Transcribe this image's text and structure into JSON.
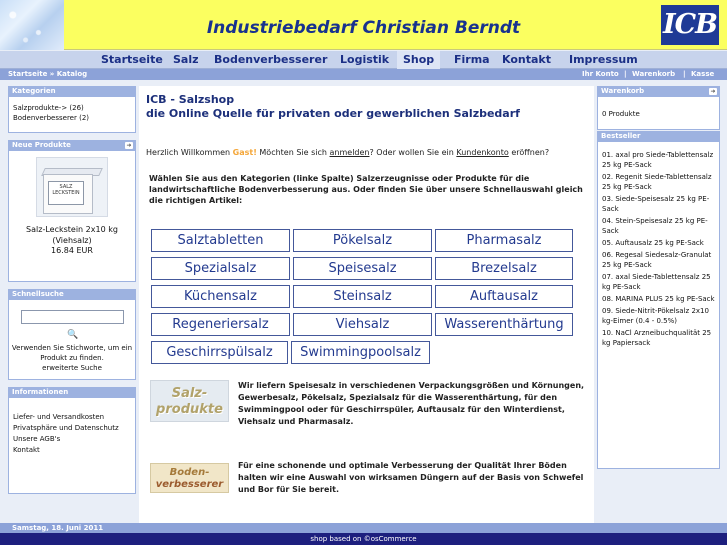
{
  "header": {
    "title": "Industriebedarf Christian Berndt",
    "logo": "ICB"
  },
  "nav": [
    "Startseite",
    "Salz",
    "Bodenverbesserer",
    "Logistik",
    "Shop",
    "Firma",
    "Kontakt",
    "Impressum"
  ],
  "nav_active": "Shop",
  "breadcrumb": "Startseite » Katalog",
  "account_links": [
    "Ihr Konto",
    "|",
    "Warenkorb",
    "|",
    "Kasse"
  ],
  "left": {
    "categories": {
      "title": "Kategorien",
      "items": [
        "Salzprodukte-> (26)",
        "Bodenverbesserer (2)"
      ]
    },
    "new_products": {
      "title": "Neue Produkte",
      "image_label": [
        "SALZ",
        "LECKSTEIN"
      ],
      "name": "Salz-Leckstein 2x10 kg (Viehsalz)",
      "price": "16.84 EUR"
    },
    "quick_search": {
      "title": "Schnellsuche",
      "input_value": "",
      "help": "Verwenden Sie Stichworte, um ein Produkt zu finden.",
      "advanced": "erweiterte Suche"
    },
    "information": {
      "title": "Informationen",
      "items": [
        "Liefer- und Versandkosten",
        "Privatsphäre und Datenschutz",
        "Unsere AGB's",
        "Kontakt"
      ]
    }
  },
  "right": {
    "cart": {
      "title": "Warenkorb",
      "text": "0 Produkte"
    },
    "bestseller": {
      "title": "Bestseller",
      "items": [
        "01. axal pro Siede-Tablettensalz 25 kg PE-Sack",
        "02. Regenit Siede-Tablettensalz 25 kg PE-Sack",
        "03. Siede-Speisesalz 25 kg PE-Sack",
        "04. Stein-Speisesalz 25 kg PE-Sack",
        "05. Auftausalz 25 kg PE-Sack",
        "06. Regesal Siedesalz-Granulat 25 kg PE-Sack",
        "07. axal Siede-Tablettensalz 25 kg PE-Sack",
        "08. MARINA PLUS 25 kg PE-Sack",
        "09. Siede-Nitrit-Pökelsalz 2x10 kg-Eimer (0.4 - 0.5%)",
        "10. NaCl Arzneibuchqualität 25 kg Papiersack"
      ]
    }
  },
  "main": {
    "title_line1": "ICB - Salzshop",
    "title_line2": "die Online Quelle für privaten oder gewerblichen Salzbedarf",
    "welcome": {
      "prefix": "Herzlich Willkommen",
      "guest": "Gast!",
      "middle": "Möchten Sie sich",
      "login": "anmelden",
      "mid2": "? Oder wollen Sie ein",
      "account": "Kundenkonto",
      "suffix": "eröffnen?"
    },
    "intro": "Wählen Sie aus den Kategorien (linke Spalte) Salzerzeugnisse oder Produkte für die landwirtschaftliche Bodenverbesserung aus. Oder finden Sie über unsere Schnellauswahl gleich die richtigen Artikel:",
    "categories": [
      "Salztabletten",
      "Pökelsalz",
      "Pharmasalz",
      "Spezialsalz",
      "Speisesalz",
      "Brezelsalz",
      "Küchensalz",
      "Steinsalz",
      "Auftausalz",
      "Regeneriersalz",
      "Viehsalz",
      "Wasserenthärtung",
      "Geschirrspülsalz",
      "Swimmingpoolsalz"
    ],
    "salz_image": [
      "Salz-",
      "produkte"
    ],
    "salz_text": "Wir liefern Speisesalz in verschiedenen Verpackungsgrößen und Körnungen, Gewerbesalz, Pökelsalz, Spezialsalz für die Wasserenthärtung, für den Swimmingpool oder für Geschirrspüler, Auftausalz für den Winterdienst, Viehsalz und Pharmasalz.",
    "boden_image": [
      "Boden-",
      "verbesserer"
    ],
    "boden_text": "Für eine schonende und optimale Verbesserung der Qualität Ihrer Böden halten wir eine Auswahl von wirksamen Düngern auf der Basis von Schwefel und Bor für Sie bereit."
  },
  "footer": {
    "date": "Samstag, 18. Juni 2011",
    "credit": "shop based on ©osCommerce"
  }
}
